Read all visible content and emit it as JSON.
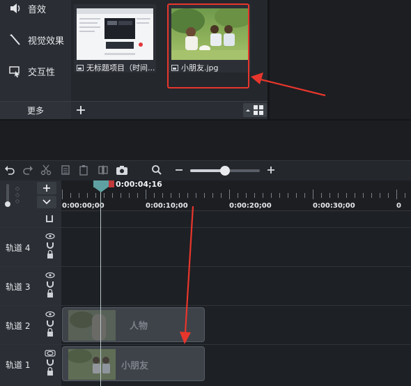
{
  "sidebar": {
    "items": [
      {
        "label": "音效",
        "icon": "speaker-icon"
      },
      {
        "label": "视觉效果",
        "icon": "magic-wand-icon"
      },
      {
        "label": "交互性",
        "icon": "interactive-cursor-icon"
      }
    ],
    "more_label": "更多"
  },
  "media_bin": {
    "items": [
      {
        "caption": "无标题项目（时间...",
        "type": "image"
      },
      {
        "caption": "小朋友.jpg",
        "type": "image"
      }
    ],
    "add_icon": "plus-icon",
    "view_icon": "grid-view-icon"
  },
  "toolbar": {
    "icons": [
      "undo-icon",
      "redo-icon",
      "cut-icon",
      "copy-icon",
      "paste-icon",
      "split-icon",
      "snapshot-icon",
      "zoom-icon",
      "zoom-out-icon",
      "zoom-in-icon"
    ],
    "zoom_level": 0.5
  },
  "timeline": {
    "playhead_time": "0:00:04;16",
    "ruler_ticks": [
      "0:00:00;00",
      "0:00:10;00",
      "0:00:20;00",
      "0:00:30;00",
      "0"
    ],
    "tracks": [
      {
        "name": "轨道 4"
      },
      {
        "name": "轨道 3"
      },
      {
        "name": "轨道 2"
      },
      {
        "name": "轨道 1"
      }
    ],
    "clips": [
      {
        "label": "人物"
      },
      {
        "label": "小朋友"
      }
    ],
    "add_track_icon": "plus-icon",
    "collapse_icon": "chevron-down-icon"
  },
  "colors": {
    "highlight": "#e8362c",
    "panel_bg": "#2a2d33",
    "timeline_bg": "#1d2024",
    "playhead_green": "#4ea64a",
    "playhead_red": "#c0393b"
  }
}
